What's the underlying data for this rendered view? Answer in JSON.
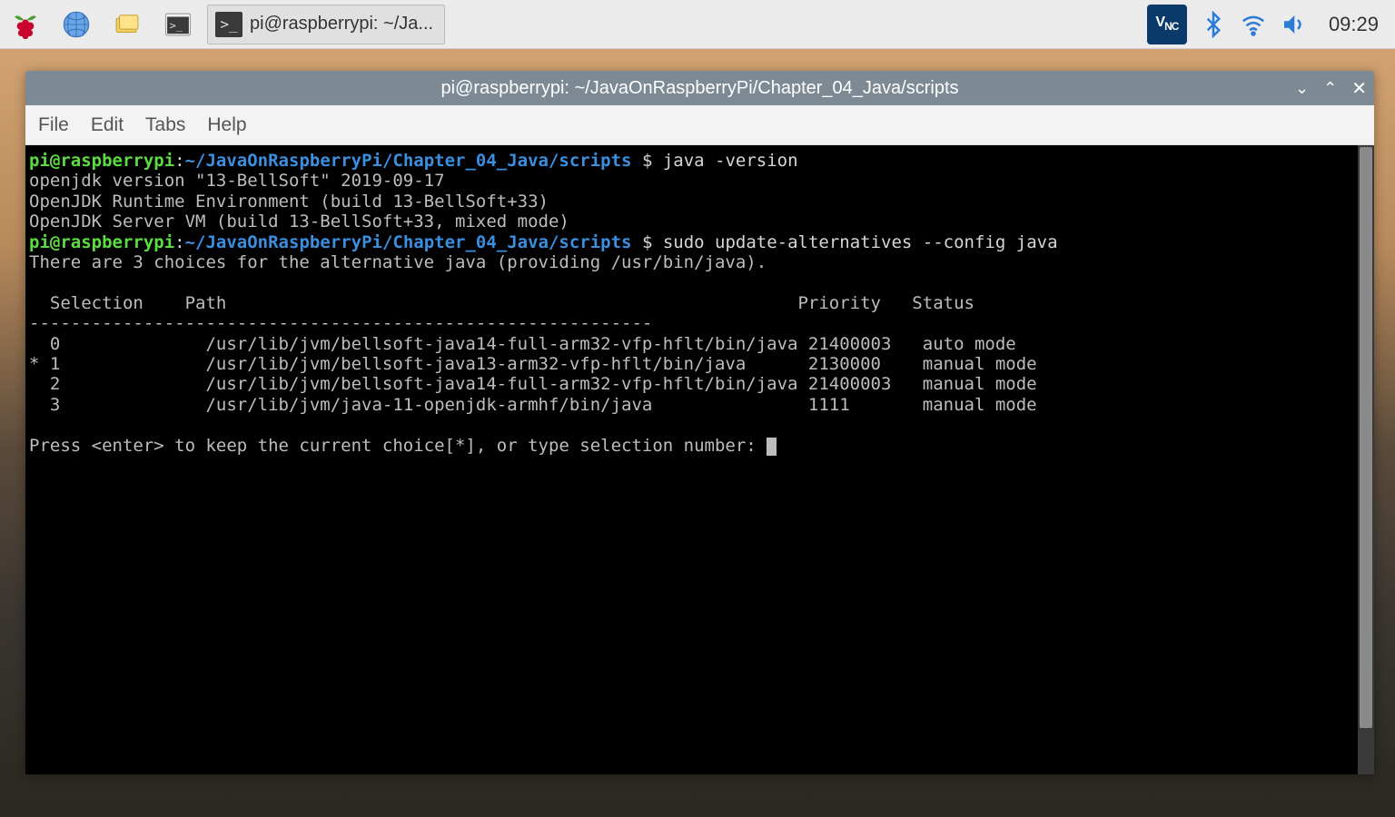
{
  "taskbar": {
    "app_label": "pi@raspberrypi: ~/Ja...",
    "clock": "09:29",
    "vnc": "VNC"
  },
  "window": {
    "title": "pi@raspberrypi: ~/JavaOnRaspberryPi/Chapter_04_Java/scripts",
    "menus": [
      "File",
      "Edit",
      "Tabs",
      "Help"
    ]
  },
  "terminal": {
    "prompt_user": "pi@raspberrypi",
    "prompt_path": "~/JavaOnRaspberryPi/Chapter_04_Java/scripts",
    "prompt_sep": " $ ",
    "cmd1": "java -version",
    "out1_1": "openjdk version \"13-BellSoft\" 2019-09-17",
    "out1_2": "OpenJDK Runtime Environment (build 13-BellSoft+33)",
    "out1_3": "OpenJDK Server VM (build 13-BellSoft+33, mixed mode)",
    "cmd2": "sudo update-alternatives --config java",
    "out2_intro": "There are 3 choices for the alternative java (providing /usr/bin/java).",
    "header_sel": "  Selection    Path",
    "header_prio": "Priority",
    "header_stat": "Status",
    "divider": "------------------------------------------------------------",
    "rows": [
      {
        "mark": " ",
        "sel": "0",
        "path": "/usr/lib/jvm/bellsoft-java14-full-arm32-vfp-hflt/bin/java",
        "prio": "21400003",
        "stat": "auto mode"
      },
      {
        "mark": "*",
        "sel": "1",
        "path": "/usr/lib/jvm/bellsoft-java13-arm32-vfp-hflt/bin/java",
        "prio": "2130000",
        "stat": "manual mode"
      },
      {
        "mark": " ",
        "sel": "2",
        "path": "/usr/lib/jvm/bellsoft-java14-full-arm32-vfp-hflt/bin/java",
        "prio": "21400003",
        "stat": "manual mode"
      },
      {
        "mark": " ",
        "sel": "3",
        "path": "/usr/lib/jvm/java-11-openjdk-armhf/bin/java",
        "prio": "1111",
        "stat": "manual mode"
      }
    ],
    "prompt_final": "Press <enter> to keep the current choice[*], or type selection number: "
  }
}
